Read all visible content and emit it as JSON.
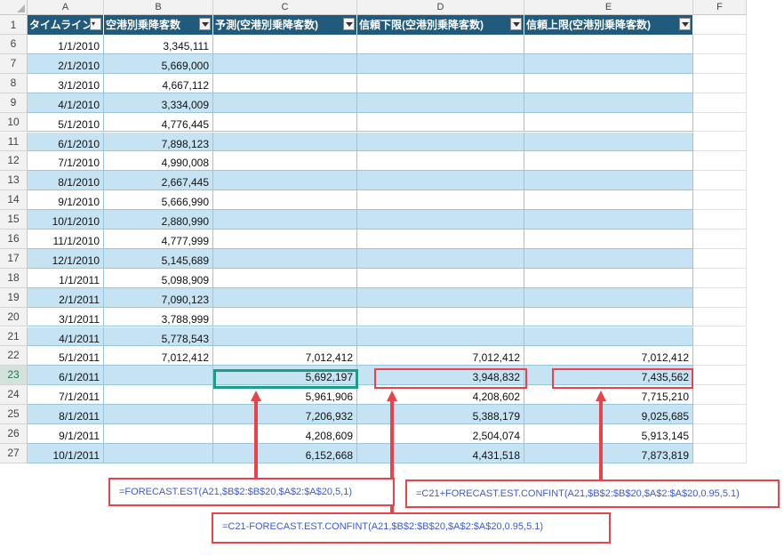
{
  "columns": [
    "A",
    "B",
    "C",
    "D",
    "E",
    "F"
  ],
  "header_row_number": "1",
  "table_headers": [
    "タイムライン",
    "空港別乗降客数",
    "予測(空港別乗降客数)",
    "信頼下限(空港別乗降客数)",
    "信頼上限(空港別乗降客数)"
  ],
  "rows": [
    {
      "num": "6",
      "a": "1/1/2010",
      "b": "3,345,111",
      "c": "",
      "d": "",
      "e": ""
    },
    {
      "num": "7",
      "a": "2/1/2010",
      "b": "5,669,000",
      "c": "",
      "d": "",
      "e": ""
    },
    {
      "num": "8",
      "a": "3/1/2010",
      "b": "4,667,112",
      "c": "",
      "d": "",
      "e": ""
    },
    {
      "num": "9",
      "a": "4/1/2010",
      "b": "3,334,009",
      "c": "",
      "d": "",
      "e": ""
    },
    {
      "num": "10",
      "a": "5/1/2010",
      "b": "4,776,445",
      "c": "",
      "d": "",
      "e": ""
    },
    {
      "num": "11",
      "a": "6/1/2010",
      "b": "7,898,123",
      "c": "",
      "d": "",
      "e": ""
    },
    {
      "num": "12",
      "a": "7/1/2010",
      "b": "4,990,008",
      "c": "",
      "d": "",
      "e": ""
    },
    {
      "num": "13",
      "a": "8/1/2010",
      "b": "2,667,445",
      "c": "",
      "d": "",
      "e": ""
    },
    {
      "num": "14",
      "a": "9/1/2010",
      "b": "5,666,990",
      "c": "",
      "d": "",
      "e": ""
    },
    {
      "num": "15",
      "a": "10/1/2010",
      "b": "2,880,990",
      "c": "",
      "d": "",
      "e": ""
    },
    {
      "num": "16",
      "a": "11/1/2010",
      "b": "4,777,999",
      "c": "",
      "d": "",
      "e": ""
    },
    {
      "num": "17",
      "a": "12/1/2010",
      "b": "5,145,689",
      "c": "",
      "d": "",
      "e": ""
    },
    {
      "num": "18",
      "a": "1/1/2011",
      "b": "5,098,909",
      "c": "",
      "d": "",
      "e": ""
    },
    {
      "num": "19",
      "a": "2/1/2011",
      "b": "7,090,123",
      "c": "",
      "d": "",
      "e": ""
    },
    {
      "num": "20",
      "a": "3/1/2011",
      "b": "3,788,999",
      "c": "",
      "d": "",
      "e": ""
    },
    {
      "num": "21",
      "a": "4/1/2011",
      "b": "5,778,543",
      "c": "",
      "d": "",
      "e": ""
    },
    {
      "num": "22",
      "a": "5/1/2011",
      "b": "7,012,412",
      "c": "7,012,412",
      "d": "7,012,412",
      "e": "7,012,412"
    },
    {
      "num": "23",
      "a": "6/1/2011",
      "b": "",
      "c": "5,692,197",
      "d": "3,948,832",
      "e": "7,435,562"
    },
    {
      "num": "24",
      "a": "7/1/2011",
      "b": "",
      "c": "5,961,906",
      "d": "4,208,602",
      "e": "7,715,210"
    },
    {
      "num": "25",
      "a": "8/1/2011",
      "b": "",
      "c": "7,206,932",
      "d": "5,388,179",
      "e": "9,025,685"
    },
    {
      "num": "26",
      "a": "9/1/2011",
      "b": "",
      "c": "4,208,609",
      "d": "2,504,074",
      "e": "5,913,145"
    },
    {
      "num": "27",
      "a": "10/1/2011",
      "b": "",
      "c": "6,152,668",
      "d": "4,431,518",
      "e": "7,873,819"
    }
  ],
  "selected_row": "23",
  "formulas": {
    "forecast": "=FORECAST.EST(A21,$B$2:$B$20,$A$2:$A$20,5,1)",
    "lower": "=C21-FORECAST.EST.CONFINT(A21,$B$2:$B$20,$A$2:$A$20,0.95,5.1)",
    "upper": "=C21+FORECAST.EST.CONFINT(A21,$B$2:$B$20,$A$2:$A$20,0.95,5.1)"
  },
  "colors": {
    "header_fill": "#205a7c",
    "band_fill": "#c6e3f3",
    "selection_green": "#1e9c86",
    "annotation_red": "#e8424a",
    "formula_text": "#3d5bd9"
  },
  "icons": [
    "select-all-triangle-icon",
    "filter-applied-icon",
    "dropdown-arrow-icon"
  ]
}
